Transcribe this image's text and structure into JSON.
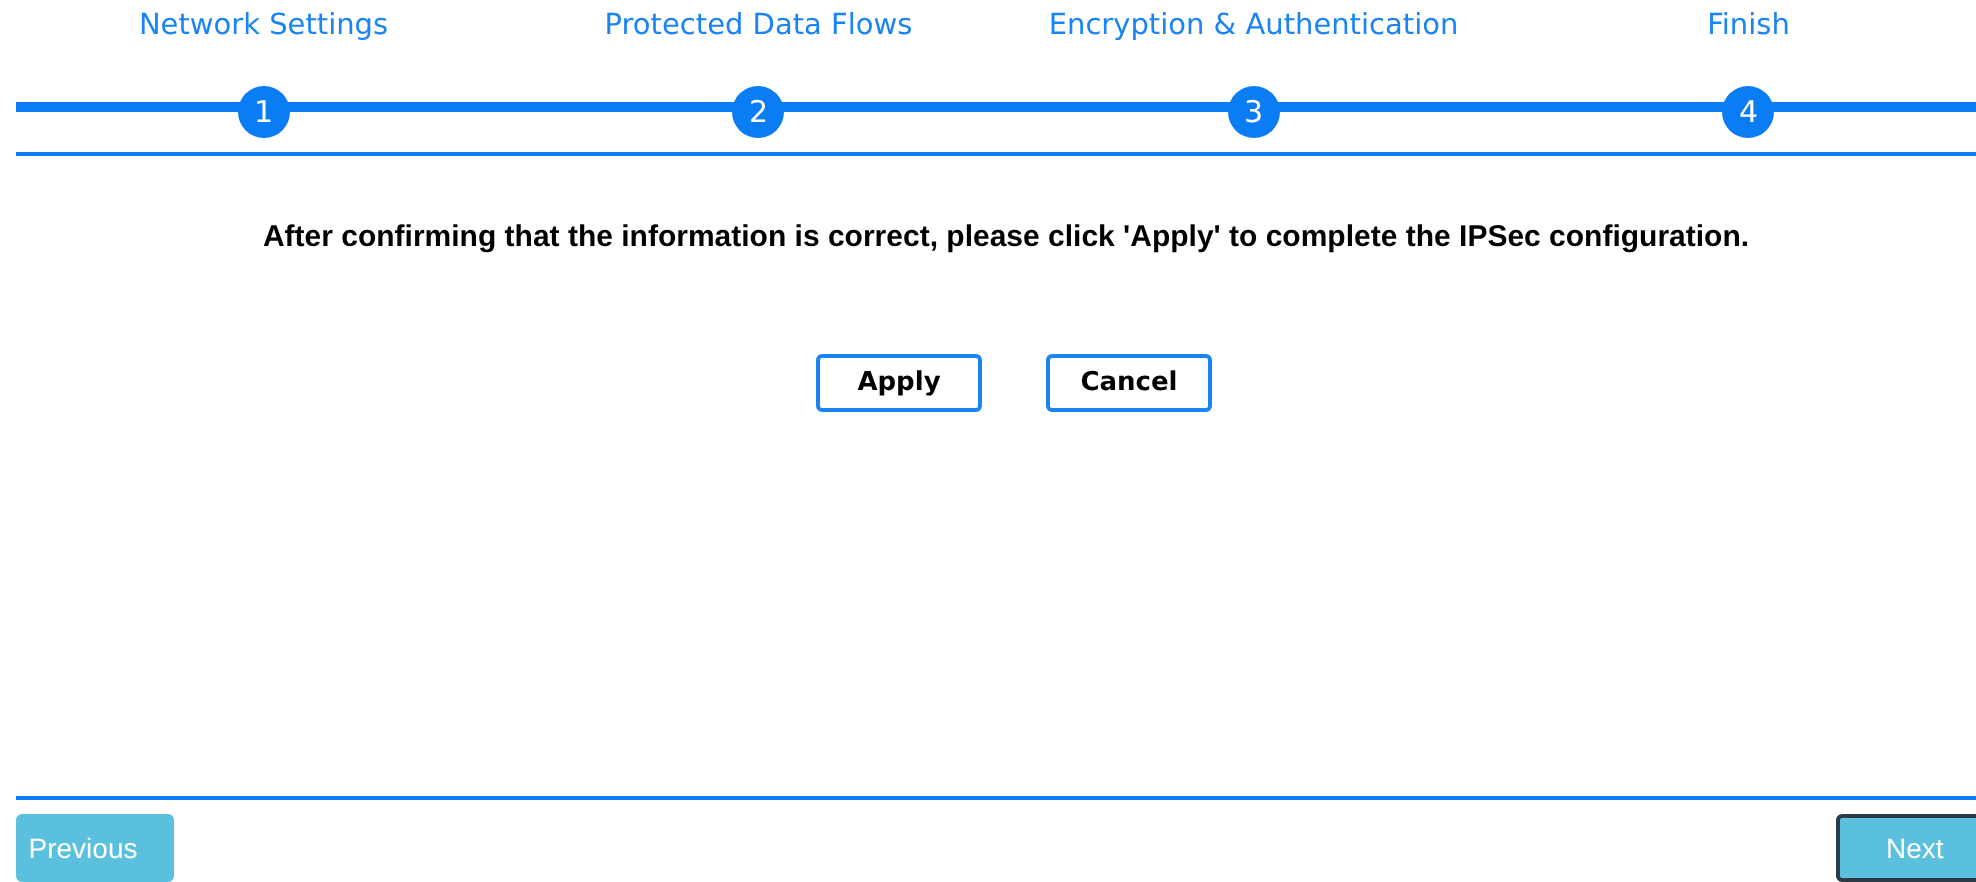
{
  "steps": [
    {
      "label": "Network Settings",
      "number": "1"
    },
    {
      "label": "Protected Data Flows",
      "number": "2"
    },
    {
      "label": "Encryption & Authentication",
      "number": "3"
    },
    {
      "label": "Finish",
      "number": "4"
    }
  ],
  "message": "After confirming that the information is correct, please click 'Apply' to complete the IPSec configuration.",
  "actions": [
    "Apply",
    "Cancel"
  ],
  "nav": {
    "previous": "Previous",
    "next": "Next"
  }
}
